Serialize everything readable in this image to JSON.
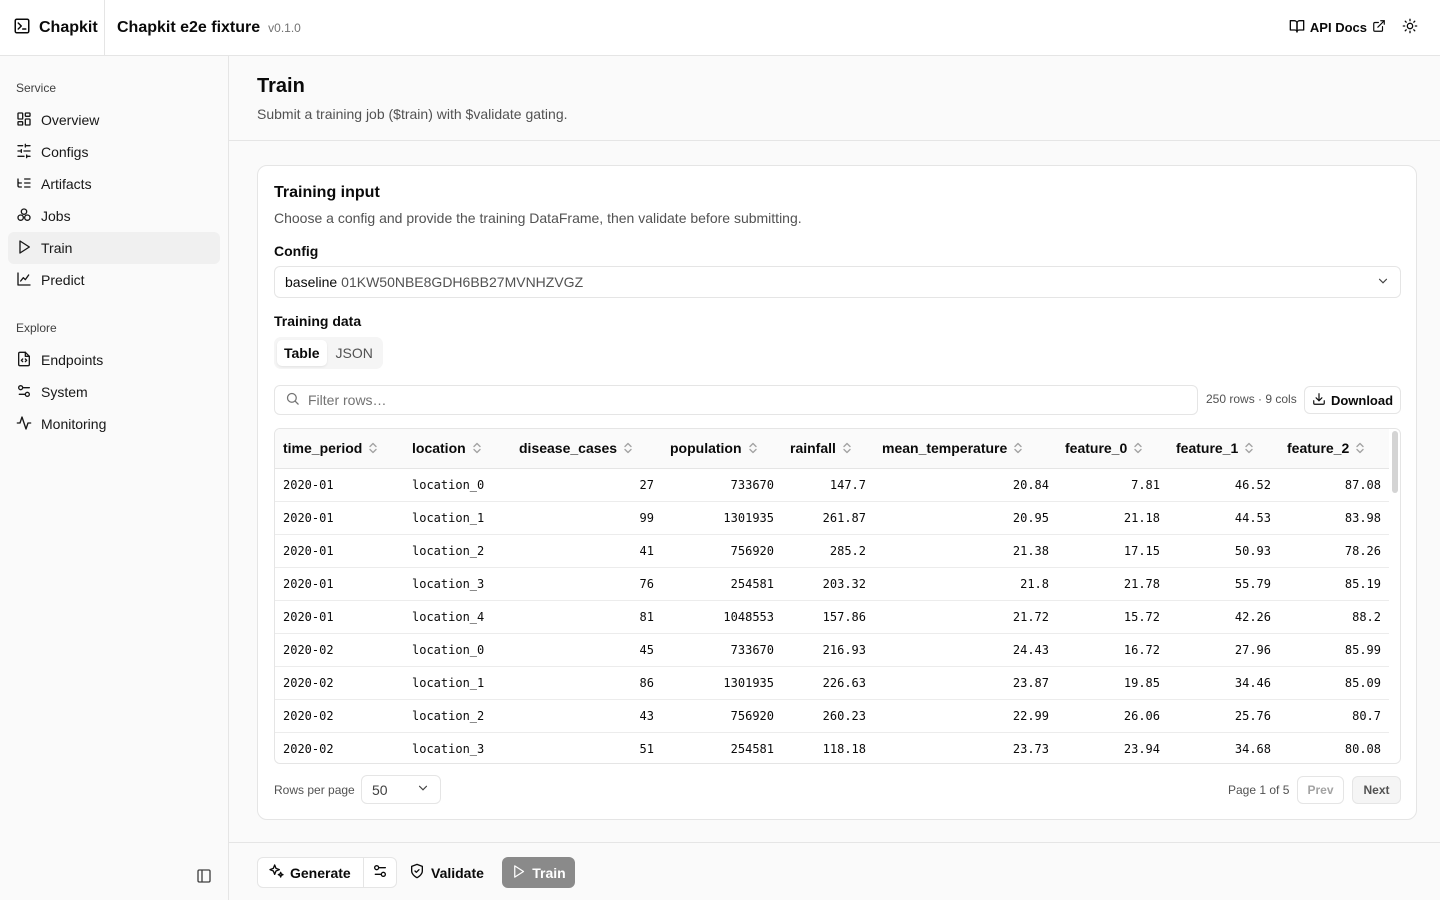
{
  "brand": {
    "name": "Chapkit"
  },
  "service": {
    "title": "Chapkit e2e fixture",
    "version": "v0.1.0"
  },
  "topbar": {
    "api_docs_label": "API Docs"
  },
  "sidebar": {
    "groups": [
      {
        "label": "Service",
        "items": [
          {
            "label": "Overview",
            "icon": "layout-grid-icon"
          },
          {
            "label": "Configs",
            "icon": "sliders-icon"
          },
          {
            "label": "Artifacts",
            "icon": "list-tree-icon"
          },
          {
            "label": "Jobs",
            "icon": "boxes-icon"
          },
          {
            "label": "Train",
            "icon": "play-icon",
            "active": true
          },
          {
            "label": "Predict",
            "icon": "line-chart-icon"
          }
        ]
      },
      {
        "label": "Explore",
        "items": [
          {
            "label": "Endpoints",
            "icon": "file-code-icon"
          },
          {
            "label": "System",
            "icon": "settings-2-icon"
          },
          {
            "label": "Monitoring",
            "icon": "activity-icon"
          }
        ]
      }
    ]
  },
  "page": {
    "title": "Train",
    "subtitle": "Submit a training job ($train) with $validate gating."
  },
  "card": {
    "title": "Training input",
    "description": "Choose a config and provide the training DataFrame, then validate before submitting.",
    "config_label": "Config",
    "config_name": "baseline",
    "config_id": "01KW50NBE8GDH6BB27MVNHZVGZ",
    "training_data_label": "Training data",
    "tabs": [
      "Table",
      "JSON"
    ],
    "active_tab": "Table",
    "filter_placeholder": "Filter rows…",
    "row_meta": "250 rows · 9 cols",
    "download_label": "Download"
  },
  "table": {
    "columns": [
      "time_period",
      "location",
      "disease_cases",
      "population",
      "rainfall",
      "mean_temperature",
      "feature_0",
      "feature_1",
      "feature_2"
    ],
    "rows": [
      [
        "2020-01",
        "location_0",
        "27",
        "733670",
        "147.7",
        "20.84",
        "7.81",
        "46.52",
        "87.08"
      ],
      [
        "2020-01",
        "location_1",
        "99",
        "1301935",
        "261.87",
        "20.95",
        "21.18",
        "44.53",
        "83.98"
      ],
      [
        "2020-01",
        "location_2",
        "41",
        "756920",
        "285.2",
        "21.38",
        "17.15",
        "50.93",
        "78.26"
      ],
      [
        "2020-01",
        "location_3",
        "76",
        "254581",
        "203.32",
        "21.8",
        "21.78",
        "55.79",
        "85.19"
      ],
      [
        "2020-01",
        "location_4",
        "81",
        "1048553",
        "157.86",
        "21.72",
        "15.72",
        "42.26",
        "88.2"
      ],
      [
        "2020-02",
        "location_0",
        "45",
        "733670",
        "216.93",
        "24.43",
        "16.72",
        "27.96",
        "85.99"
      ],
      [
        "2020-02",
        "location_1",
        "86",
        "1301935",
        "226.63",
        "23.87",
        "19.85",
        "34.46",
        "85.09"
      ],
      [
        "2020-02",
        "location_2",
        "43",
        "756920",
        "260.23",
        "22.99",
        "26.06",
        "25.76",
        "80.7"
      ],
      [
        "2020-02",
        "location_3",
        "51",
        "254581",
        "118.18",
        "23.73",
        "23.94",
        "34.68",
        "80.08"
      ]
    ]
  },
  "pagination": {
    "rows_per_page_label": "Rows per page",
    "rows_per_page": "50",
    "page_info": "Page 1 of 5",
    "prev_label": "Prev",
    "next_label": "Next"
  },
  "footer": {
    "generate_label": "Generate",
    "validate_label": "Validate",
    "train_label": "Train"
  },
  "colors": {
    "accent": "#0a0a0a",
    "muted": "#737373",
    "border": "#e5e5e5",
    "train_disabled": "#8a8a8a"
  }
}
